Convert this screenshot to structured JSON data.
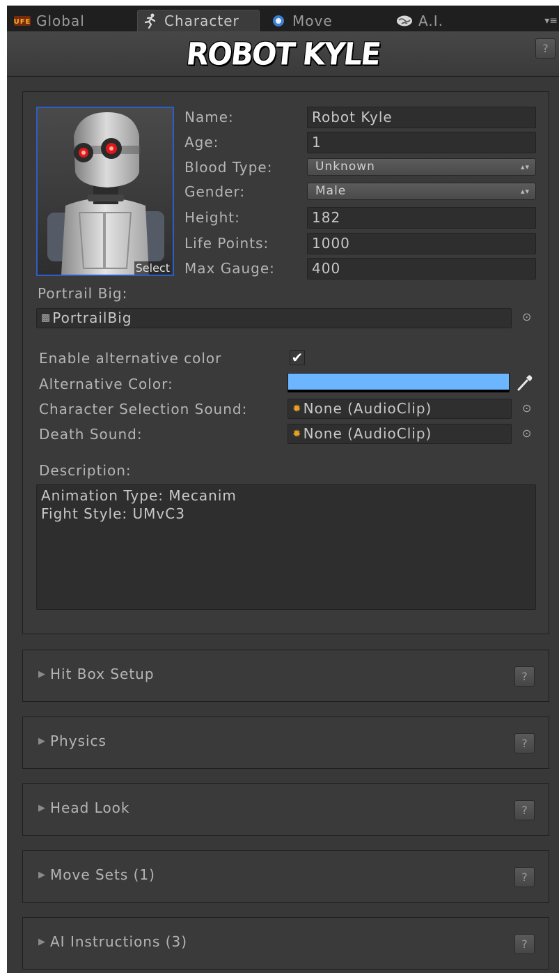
{
  "tabs": [
    {
      "label": "Global",
      "icon": "ufe-logo-icon"
    },
    {
      "label": "Character",
      "icon": "running-figure-icon"
    },
    {
      "label": "Move",
      "icon": "move-orb-icon"
    },
    {
      "label": "A.I.",
      "icon": "brain-icon"
    }
  ],
  "header": {
    "title": "ROBOT KYLE",
    "help_label": "?"
  },
  "portrait": {
    "select_label": "Select"
  },
  "fields": {
    "name": {
      "label": "Name:",
      "value": "Robot Kyle"
    },
    "age": {
      "label": "Age:",
      "value": "1"
    },
    "blood_type": {
      "label": "Blood Type:",
      "value": "Unknown"
    },
    "gender": {
      "label": "Gender:",
      "value": "Male"
    },
    "height": {
      "label": "Height:",
      "value": "182"
    },
    "life_points": {
      "label": "Life Points:",
      "value": "1000"
    },
    "max_gauge": {
      "label": "Max Gauge:",
      "value": "400"
    }
  },
  "portrait_big": {
    "label": "Portrail Big:",
    "value": "PortrailBig"
  },
  "alt_color": {
    "enable_label": "Enable alternative color",
    "enabled": true,
    "color_label": "Alternative Color:",
    "color": "#6cb6ff"
  },
  "sounds": {
    "selection": {
      "label": "Character Selection Sound:",
      "value": "None (AudioClip)"
    },
    "death": {
      "label": "Death Sound:",
      "value": "None (AudioClip)"
    }
  },
  "description": {
    "label": "Description:",
    "lines": [
      "Animation Type: Mecanim",
      "Fight Style: UMvC3"
    ]
  },
  "sections": [
    {
      "label": "Hit Box Setup",
      "help": "?"
    },
    {
      "label": "Physics",
      "help": "?"
    },
    {
      "label": "Head Look",
      "help": "?"
    },
    {
      "label": "Move Sets (1)",
      "help": "?"
    },
    {
      "label": "AI Instructions (3)",
      "help": "?"
    }
  ],
  "colors": {
    "background": "#383838",
    "selection_border": "#2d5dc8",
    "accent": "#6cb6ff"
  }
}
